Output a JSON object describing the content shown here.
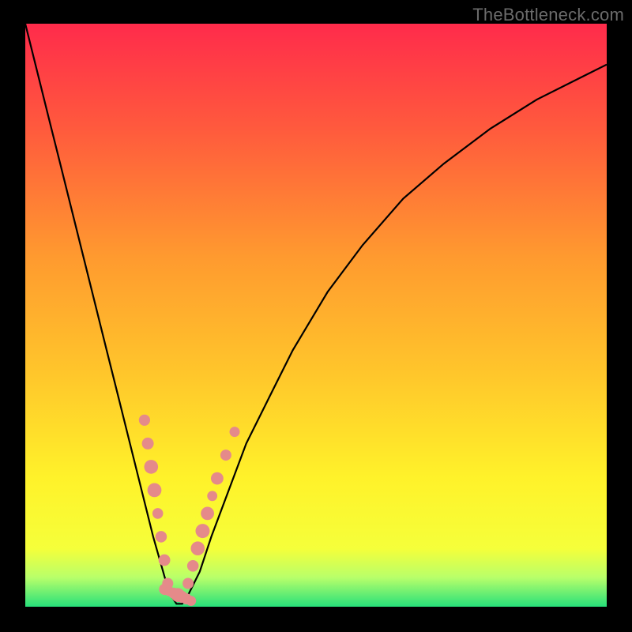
{
  "watermark": "TheBottleneck.com",
  "gradient_colors": {
    "c0": "#ff2b4b",
    "c1": "#ff5a3d",
    "c2": "#ff9a2f",
    "c3": "#ffc62b",
    "c4": "#fff22a",
    "c5": "#f5ff3a",
    "c6": "#b8ff6a",
    "c7": "#27e07a"
  },
  "chart_data": {
    "type": "line",
    "title": "",
    "xlabel": "",
    "ylabel": "",
    "xlim": [
      0,
      100
    ],
    "ylim": [
      0,
      100
    ],
    "series": [
      {
        "name": "bottleneck-curve",
        "x": [
          0,
          2,
          4,
          6,
          8,
          10,
          12,
          14,
          16,
          18,
          20,
          22,
          24,
          25,
          26,
          27,
          28,
          30,
          32,
          35,
          38,
          42,
          46,
          52,
          58,
          65,
          72,
          80,
          88,
          96,
          100
        ],
        "y": [
          100,
          92,
          84,
          76,
          68,
          60,
          52,
          44,
          36,
          28,
          20,
          12,
          5,
          2,
          0.5,
          0.5,
          2,
          6,
          12,
          20,
          28,
          36,
          44,
          54,
          62,
          70,
          76,
          82,
          87,
          91,
          93
        ]
      }
    ],
    "marker_clusters": [
      {
        "x0": 20.5,
        "y0": 32,
        "x1": 24.5,
        "y1": 4,
        "count": 8
      },
      {
        "x0": 24.0,
        "y0": 3,
        "x1": 28.5,
        "y1": 1,
        "count": 7
      },
      {
        "x0": 28.0,
        "y0": 4,
        "x1": 33.0,
        "y1": 22,
        "count": 7
      },
      {
        "x0": 33.0,
        "y0": 22,
        "x1": 36.0,
        "y1": 30,
        "count": 3
      }
    ],
    "marker_color": "#e58a8a",
    "curve_color": "#000000",
    "curve_width": 2.2
  }
}
